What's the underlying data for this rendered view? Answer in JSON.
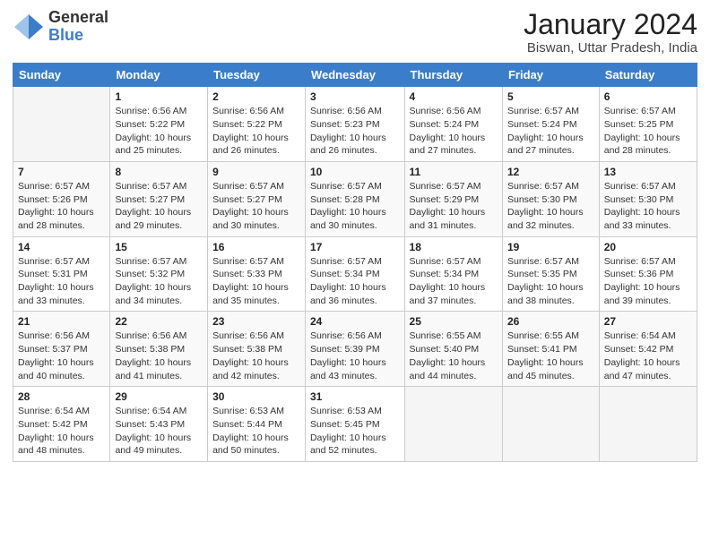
{
  "logo": {
    "general": "General",
    "blue": "Blue"
  },
  "title": "January 2024",
  "subtitle": "Biswan, Uttar Pradesh, India",
  "days_of_week": [
    "Sunday",
    "Monday",
    "Tuesday",
    "Wednesday",
    "Thursday",
    "Friday",
    "Saturday"
  ],
  "weeks": [
    [
      {
        "day": "",
        "info": ""
      },
      {
        "day": "1",
        "info": "Sunrise: 6:56 AM\nSunset: 5:22 PM\nDaylight: 10 hours\nand 25 minutes."
      },
      {
        "day": "2",
        "info": "Sunrise: 6:56 AM\nSunset: 5:22 PM\nDaylight: 10 hours\nand 26 minutes."
      },
      {
        "day": "3",
        "info": "Sunrise: 6:56 AM\nSunset: 5:23 PM\nDaylight: 10 hours\nand 26 minutes."
      },
      {
        "day": "4",
        "info": "Sunrise: 6:56 AM\nSunset: 5:24 PM\nDaylight: 10 hours\nand 27 minutes."
      },
      {
        "day": "5",
        "info": "Sunrise: 6:57 AM\nSunset: 5:24 PM\nDaylight: 10 hours\nand 27 minutes."
      },
      {
        "day": "6",
        "info": "Sunrise: 6:57 AM\nSunset: 5:25 PM\nDaylight: 10 hours\nand 28 minutes."
      }
    ],
    [
      {
        "day": "7",
        "info": "Sunrise: 6:57 AM\nSunset: 5:26 PM\nDaylight: 10 hours\nand 28 minutes."
      },
      {
        "day": "8",
        "info": "Sunrise: 6:57 AM\nSunset: 5:27 PM\nDaylight: 10 hours\nand 29 minutes."
      },
      {
        "day": "9",
        "info": "Sunrise: 6:57 AM\nSunset: 5:27 PM\nDaylight: 10 hours\nand 30 minutes."
      },
      {
        "day": "10",
        "info": "Sunrise: 6:57 AM\nSunset: 5:28 PM\nDaylight: 10 hours\nand 30 minutes."
      },
      {
        "day": "11",
        "info": "Sunrise: 6:57 AM\nSunset: 5:29 PM\nDaylight: 10 hours\nand 31 minutes."
      },
      {
        "day": "12",
        "info": "Sunrise: 6:57 AM\nSunset: 5:30 PM\nDaylight: 10 hours\nand 32 minutes."
      },
      {
        "day": "13",
        "info": "Sunrise: 6:57 AM\nSunset: 5:30 PM\nDaylight: 10 hours\nand 33 minutes."
      }
    ],
    [
      {
        "day": "14",
        "info": "Sunrise: 6:57 AM\nSunset: 5:31 PM\nDaylight: 10 hours\nand 33 minutes."
      },
      {
        "day": "15",
        "info": "Sunrise: 6:57 AM\nSunset: 5:32 PM\nDaylight: 10 hours\nand 34 minutes."
      },
      {
        "day": "16",
        "info": "Sunrise: 6:57 AM\nSunset: 5:33 PM\nDaylight: 10 hours\nand 35 minutes."
      },
      {
        "day": "17",
        "info": "Sunrise: 6:57 AM\nSunset: 5:34 PM\nDaylight: 10 hours\nand 36 minutes."
      },
      {
        "day": "18",
        "info": "Sunrise: 6:57 AM\nSunset: 5:34 PM\nDaylight: 10 hours\nand 37 minutes."
      },
      {
        "day": "19",
        "info": "Sunrise: 6:57 AM\nSunset: 5:35 PM\nDaylight: 10 hours\nand 38 minutes."
      },
      {
        "day": "20",
        "info": "Sunrise: 6:57 AM\nSunset: 5:36 PM\nDaylight: 10 hours\nand 39 minutes."
      }
    ],
    [
      {
        "day": "21",
        "info": "Sunrise: 6:56 AM\nSunset: 5:37 PM\nDaylight: 10 hours\nand 40 minutes."
      },
      {
        "day": "22",
        "info": "Sunrise: 6:56 AM\nSunset: 5:38 PM\nDaylight: 10 hours\nand 41 minutes."
      },
      {
        "day": "23",
        "info": "Sunrise: 6:56 AM\nSunset: 5:38 PM\nDaylight: 10 hours\nand 42 minutes."
      },
      {
        "day": "24",
        "info": "Sunrise: 6:56 AM\nSunset: 5:39 PM\nDaylight: 10 hours\nand 43 minutes."
      },
      {
        "day": "25",
        "info": "Sunrise: 6:55 AM\nSunset: 5:40 PM\nDaylight: 10 hours\nand 44 minutes."
      },
      {
        "day": "26",
        "info": "Sunrise: 6:55 AM\nSunset: 5:41 PM\nDaylight: 10 hours\nand 45 minutes."
      },
      {
        "day": "27",
        "info": "Sunrise: 6:54 AM\nSunset: 5:42 PM\nDaylight: 10 hours\nand 47 minutes."
      }
    ],
    [
      {
        "day": "28",
        "info": "Sunrise: 6:54 AM\nSunset: 5:42 PM\nDaylight: 10 hours\nand 48 minutes."
      },
      {
        "day": "29",
        "info": "Sunrise: 6:54 AM\nSunset: 5:43 PM\nDaylight: 10 hours\nand 49 minutes."
      },
      {
        "day": "30",
        "info": "Sunrise: 6:53 AM\nSunset: 5:44 PM\nDaylight: 10 hours\nand 50 minutes."
      },
      {
        "day": "31",
        "info": "Sunrise: 6:53 AM\nSunset: 5:45 PM\nDaylight: 10 hours\nand 52 minutes."
      },
      {
        "day": "",
        "info": ""
      },
      {
        "day": "",
        "info": ""
      },
      {
        "day": "",
        "info": ""
      }
    ]
  ]
}
